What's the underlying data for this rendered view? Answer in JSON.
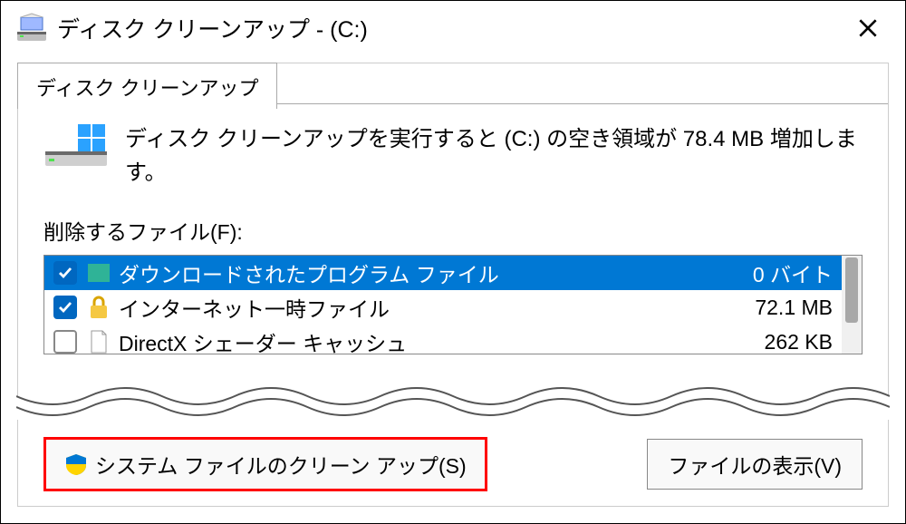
{
  "window": {
    "title": "ディスク クリーンアップ - (C:)"
  },
  "tab": {
    "label": "ディスク クリーンアップ"
  },
  "summary": {
    "text": "ディスク クリーンアップを実行すると (C:) の空き領域が 78.4 MB 増加します。"
  },
  "files_to_delete": {
    "label": "削除するファイル(F):",
    "items": [
      {
        "checked": true,
        "selected": true,
        "icon": "folder",
        "label": "ダウンロードされたプログラム ファイル",
        "size": "0 バイト"
      },
      {
        "checked": true,
        "selected": false,
        "icon": "lock",
        "label": "インターネット一時ファイル",
        "size": "72.1 MB"
      },
      {
        "checked": false,
        "selected": false,
        "icon": "file",
        "label": "DirectX シェーダー キャッシュ",
        "size": "262 KB"
      }
    ]
  },
  "buttons": {
    "system_clean": "システム ファイルのクリーン アップ(S)",
    "view_files": "ファイルの表示(V)"
  }
}
